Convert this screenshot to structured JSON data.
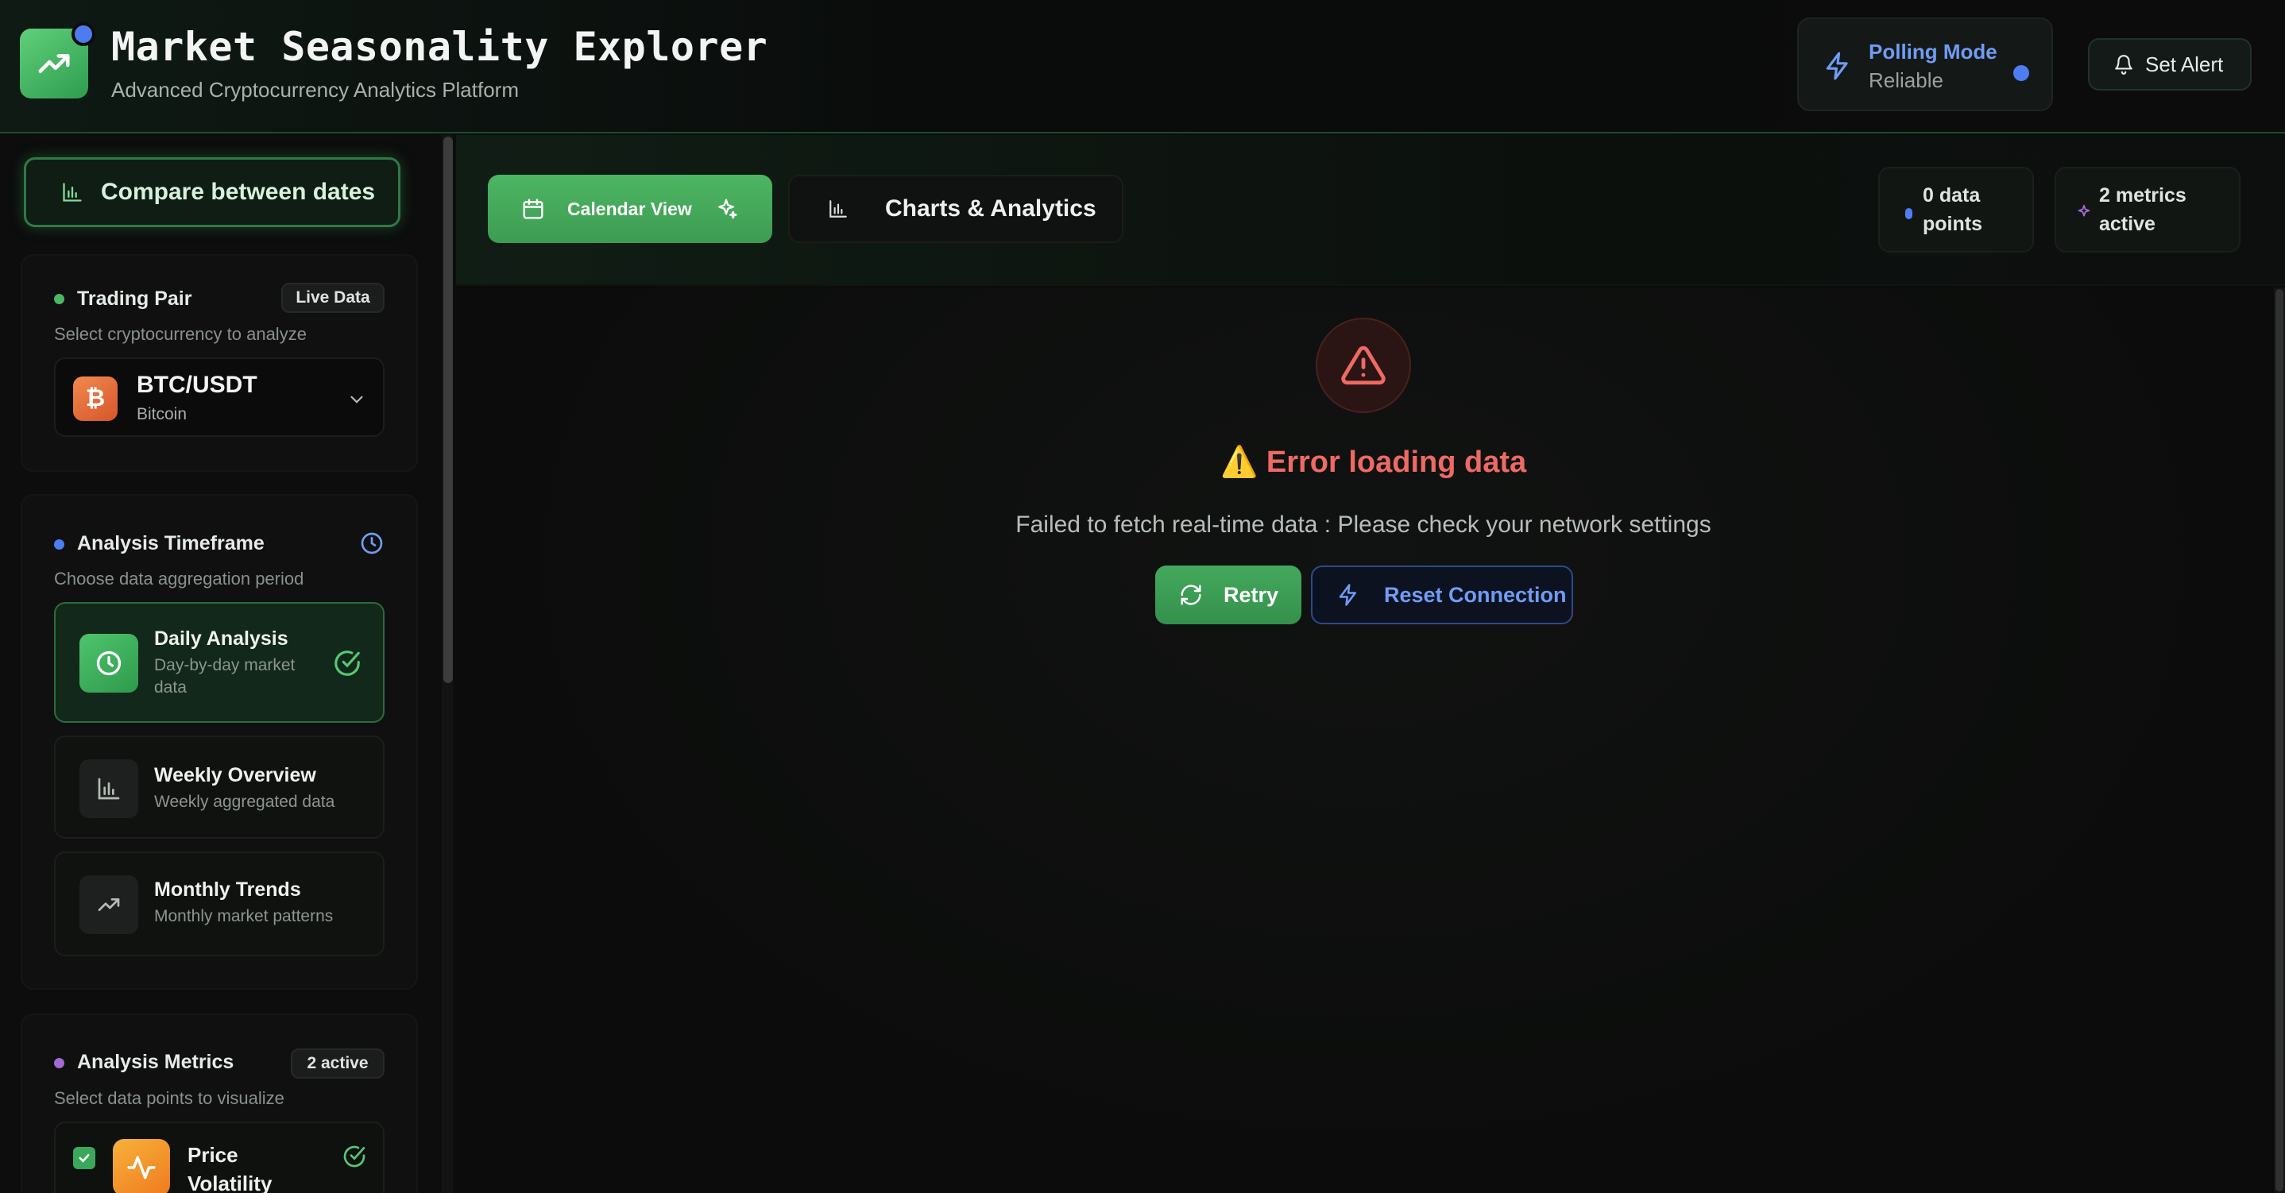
{
  "header": {
    "title": "Market Seasonality Explorer",
    "subtitle": "Advanced Cryptocurrency Analytics Platform",
    "polling_mode": "Polling Mode",
    "polling_status": "Reliable",
    "set_alert": "Set Alert"
  },
  "sidebar": {
    "compare_label": "Compare between dates",
    "trading_pair": {
      "title": "Trading Pair",
      "badge": "Live Data",
      "description": "Select cryptocurrency to analyze",
      "selected_symbol": "BTC/USDT",
      "selected_name": "Bitcoin",
      "icon_glyph": "₿"
    },
    "timeframe": {
      "title": "Analysis Timeframe",
      "description": "Choose data aggregation period",
      "options": [
        {
          "title": "Daily Analysis",
          "subtitle": "Day-by-day market data",
          "active": true
        },
        {
          "title": "Weekly Overview",
          "subtitle": "Weekly aggregated data",
          "active": false
        },
        {
          "title": "Monthly Trends",
          "subtitle": "Monthly market patterns",
          "active": false
        }
      ]
    },
    "metrics": {
      "title": "Analysis Metrics",
      "badge": "2 active",
      "description": "Select data points to visualize",
      "items": [
        {
          "title": "Price Volatility",
          "checked": true
        }
      ]
    }
  },
  "main": {
    "tabs": {
      "calendar": "Calendar View",
      "charts": "Charts & Analytics"
    },
    "stats": {
      "data_points": "0 data points",
      "metrics_active": "2 metrics active"
    },
    "error": {
      "title": "⚠️ Error loading data",
      "message": "Failed to fetch real-time data : Please check your network settings",
      "retry": "Retry",
      "reset": "Reset Connection"
    }
  },
  "colors": {
    "accent_green": "#4db563",
    "accent_blue": "#6f9cf5",
    "error_red": "#ee6a63",
    "purple": "#a36ad6"
  }
}
